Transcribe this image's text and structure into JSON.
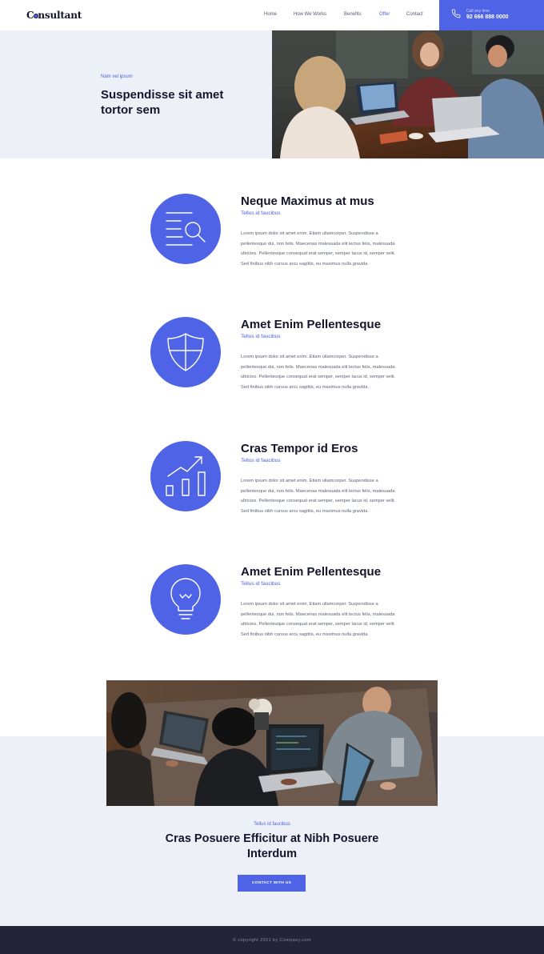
{
  "header": {
    "logo_before": "C",
    "logo_after": "nsultant",
    "nav": [
      "Home",
      "How We Works",
      "Benefits",
      "Offer",
      "Contact"
    ],
    "active_nav": "Offer",
    "call_label": "Call any time",
    "call_number": "92 666 888 0000",
    "accent": "#4f63e6"
  },
  "hero": {
    "kicker": "Nam vel ipsum",
    "title": "Suspendisse sit amet tortor sem",
    "photo": "people-with-laptops-photo"
  },
  "features": [
    {
      "title": "Neque Maximus at mus",
      "subtitle": "Tellus id faucibus",
      "body": "Lorem ipsum dolor sit amet enim. Etiam ullamcorper. Suspendisse a pellentesque dui, non felis. Maecenas malesuada elit lectus felis, malesuada ultricies. Pellentesque consequat erat semper, semper lacus id, semper velit. Sed finibus nibh cursus arcu sagittis, eu maximus nulla gravida.",
      "icon": "document-search-icon"
    },
    {
      "title": "Amet Enim Pellentesque",
      "subtitle": "Tellus id faucibus",
      "body": "Lorem ipsum dolor sit amet enim. Etiam ullamcorper. Suspendisse a pellentesque dui, non felis. Maecenas malesuada elit lectus felis, malesuada ultricies. Pellentesque consequat erat semper, semper lacus id, semper velit. Sed finibus nibh cursus arcu sagittis, eu maximus nulla gravida.",
      "icon": "shield-icon"
    },
    {
      "title": "Cras Tempor id Eros",
      "subtitle": "Tellus id faucibus",
      "body": "Lorem ipsum dolor sit amet enim. Etiam ullamcorper. Suspendisse a pellentesque dui, non felis. Maecenas malesuada elit lectus felis, malesuada ultricies. Pellentesque consequat erat semper, semper lacus id, semper velit. Sed finibus nibh cursus arcu sagittis, eu maximus nulla gravida.",
      "icon": "growth-chart-icon"
    },
    {
      "title": "Amet Enim Pellentesque",
      "subtitle": "Tellus id faucibus",
      "body": "Lorem ipsum dolor sit amet enim. Etiam ullamcorper. Suspendisse a pellentesque dui, non felis. Maecenas malesuada elit lectus felis, malesuada ultricies. Pellentesque consequat erat semper, semper lacus id, semper velit. Sed finibus nibh cursus arcu sagittis, eu maximus nulla gravida.",
      "icon": "lightbulb-icon"
    }
  ],
  "cta": {
    "photo": "team-coding-photo",
    "kicker": "Tellus id faucibus",
    "title": "Cras Posuere Efficitur at Nibh Posuere Interdum",
    "button": "CONTACT WITH US"
  },
  "footer": {
    "copyright": "© copyright 2021 by Company.com"
  }
}
